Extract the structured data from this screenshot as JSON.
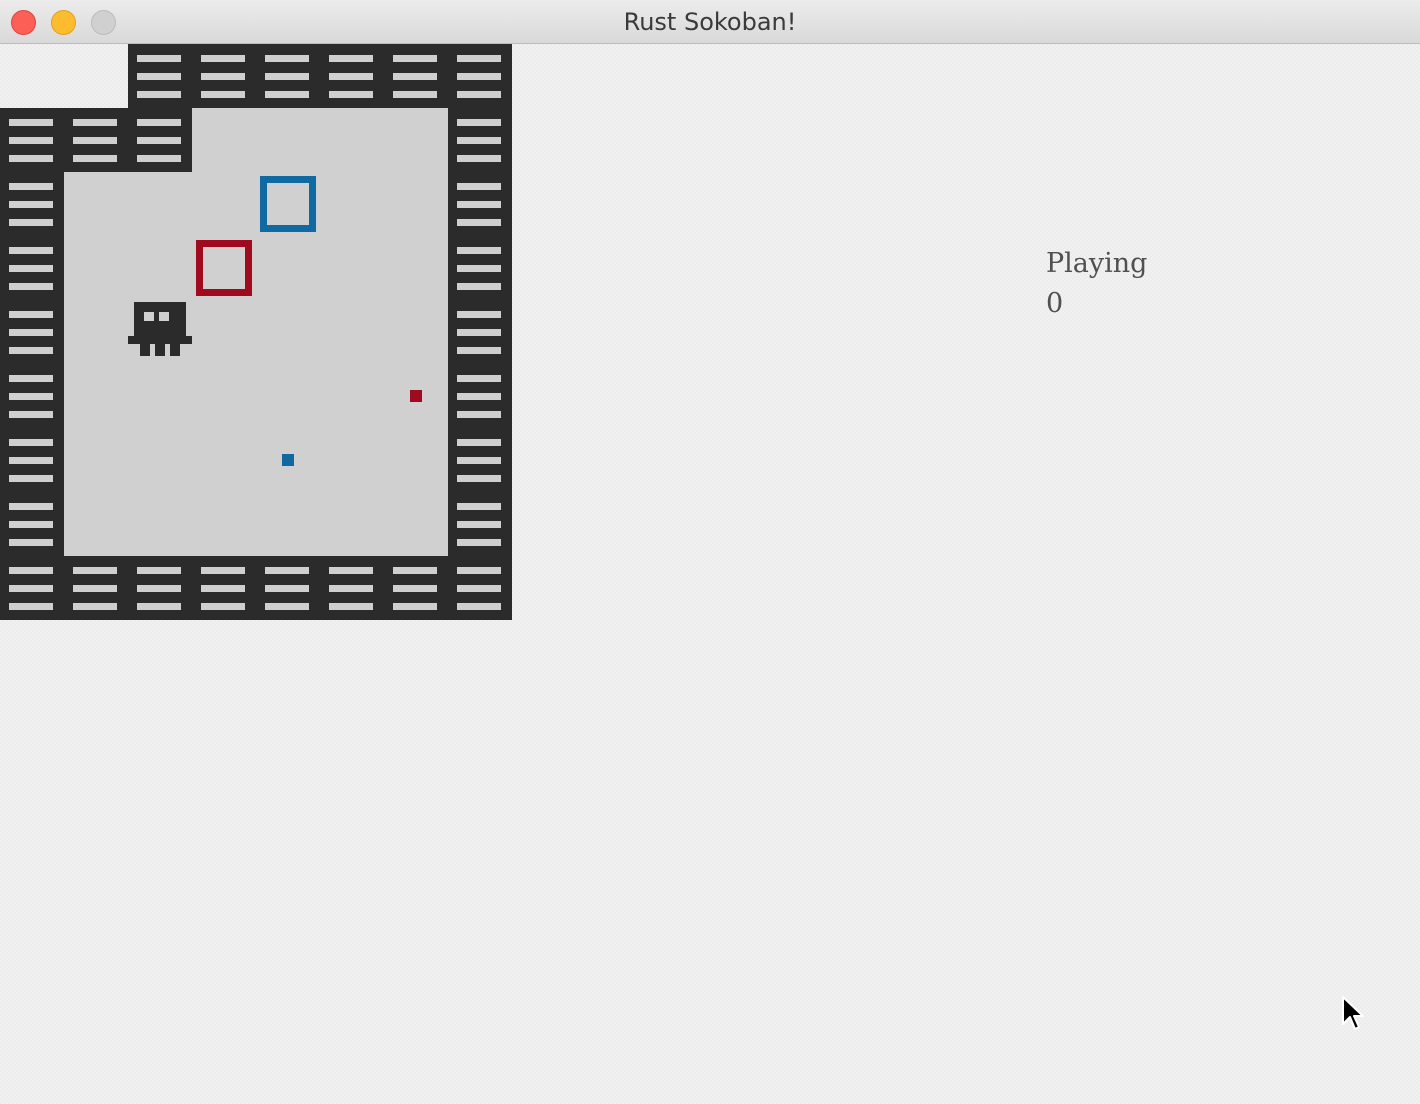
{
  "window": {
    "title": "Rust Sokoban!",
    "controls": [
      "close",
      "minimize",
      "zoom"
    ]
  },
  "hud": {
    "state": "Playing",
    "steps": "0"
  },
  "level": {
    "map": [
      "  WWWWWW",
      "WWW    W",
      "W   B  W",
      "W  R   W",
      "W P    W",
      "W     rW",
      "W   b  W",
      "W      W",
      "WWWWWWWW"
    ],
    "legend": {
      "W": "wall",
      " ": "floor",
      "P": "player",
      "B": "blue-box",
      "R": "red-box",
      "b": "blue-box-spot",
      "r": "red-box-spot"
    },
    "colors": {
      "wall": "#2b2b2b",
      "wall_stripe": "#cfcfcf",
      "floor": "#d0d0d0",
      "blue": "#0e6aa0",
      "red": "#a00a1e",
      "player": "#2b2b2b"
    }
  },
  "icons": {
    "cursor": "arrow-cursor-icon"
  }
}
